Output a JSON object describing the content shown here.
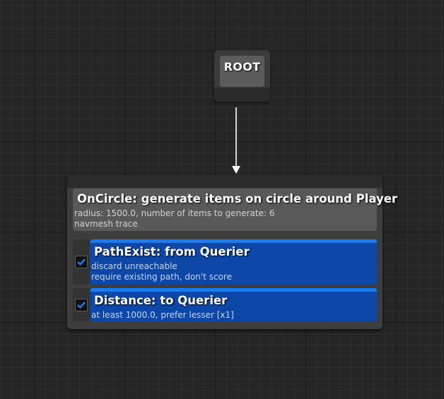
{
  "graph": {
    "root_node": {
      "label": "ROOT"
    },
    "generator_node": {
      "title": "OnCircle: generate items on circle around Player",
      "details": [
        "radius: 1500.0, number of items to generate: 6",
        "navmesh trace"
      ],
      "tests": [
        {
          "enabled": true,
          "title": "PathExist: from Querier",
          "details": [
            "discard unreachable",
            "require existing path, don't score"
          ]
        },
        {
          "enabled": true,
          "title": "Distance: to Querier",
          "details": [
            "at least 1000.0, prefer lesser [x1]"
          ]
        }
      ]
    }
  },
  "colors": {
    "canvas_background": "#262626",
    "node_body": "#3d3d3d",
    "node_header": "#595959",
    "test_panel": "#0d47a8",
    "test_accent": "#1a7cf0",
    "checkmark": "#1e88ff",
    "connector": "#ffffff"
  },
  "icons": {
    "checkbox_checked": "checkmark-icon",
    "connector_arrow": "arrow-down-icon"
  }
}
